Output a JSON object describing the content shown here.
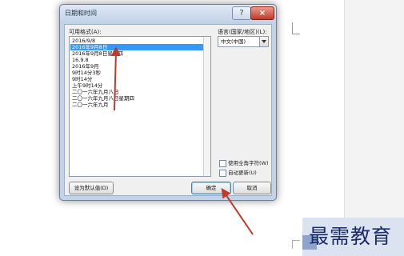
{
  "dialog": {
    "title": "日期和时间",
    "help_symbol": "?",
    "close_symbol": "×"
  },
  "formats": {
    "label": "可用格式(A):",
    "items": [
      "2016/9/8",
      "2016年9月8日",
      "2016年9月8日星期四",
      "16.9.8",
      "2016年9月",
      "9时14分3秒",
      "9时14分",
      "上午9时14分",
      "二〇一六年九月八日",
      "二〇一六年九月八日星期四",
      "二〇一六年九月"
    ],
    "selected_index": 1
  },
  "language": {
    "label": "语言(国家/地区)(L):",
    "value": "中文(中国)"
  },
  "options": {
    "fullwidth_label": "使用全角字符(W)",
    "fullwidth_checked": false,
    "auto_update_label": "自动更新(U)",
    "auto_update_checked": false
  },
  "buttons": {
    "set_default": "设为默认值(D)",
    "ok": "确定",
    "cancel": "取消"
  },
  "watermark": {
    "text": "最需教育"
  },
  "colors": {
    "selection": "#3399ff",
    "annotation_arrow": "#c0392b",
    "close_button": "#c0392b"
  }
}
